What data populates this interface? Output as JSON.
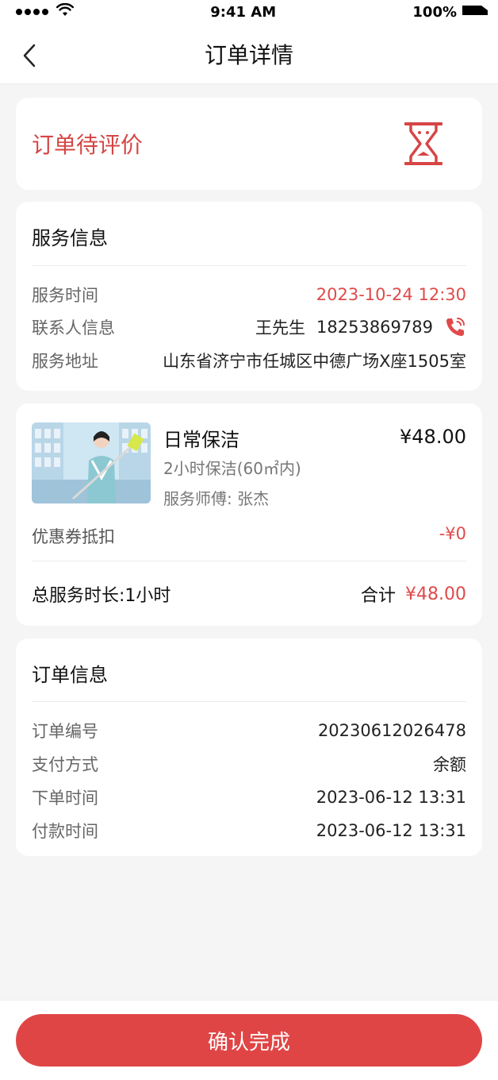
{
  "status_bar": {
    "time": "9:41 AM",
    "battery": "100%"
  },
  "nav": {
    "title": "订单详情",
    "back_icon": "chevron-left-icon"
  },
  "order_status": {
    "text": "订单待评价",
    "icon": "hourglass-icon",
    "color": "#d64545"
  },
  "service_info": {
    "title": "服务信息",
    "rows": [
      {
        "label": "服务时间",
        "value": "2023-10-24 12:30"
      },
      {
        "label": "联系人信息",
        "name": "王先生",
        "phone": "18253869789"
      },
      {
        "label": "服务地址",
        "value": "山东省济宁市任城区中德广场X座1505室"
      }
    ]
  },
  "product": {
    "name": "日常保洁",
    "price": "¥48.00",
    "spec": "2小时保洁(60㎡内)",
    "master": "服务师傅: 张杰",
    "coupon_label": "优惠券抵扣",
    "coupon_value": "-¥0",
    "total_duration": "总服务时长:1小时",
    "total_label": "合计",
    "total_amount": "¥48.00"
  },
  "order_info": {
    "title": "订单信息",
    "rows": [
      {
        "label": "订单编号",
        "value": "20230612026478"
      },
      {
        "label": "支付方式",
        "value": "余额"
      },
      {
        "label": "下单时间",
        "value": "2023-06-12 13:31"
      },
      {
        "label": "付款时间",
        "value": "2023-06-12 13:31"
      }
    ]
  },
  "bottom": {
    "confirm_label": "确认完成"
  },
  "colors": {
    "accent": "#e04545",
    "background": "#f5f5f5"
  }
}
